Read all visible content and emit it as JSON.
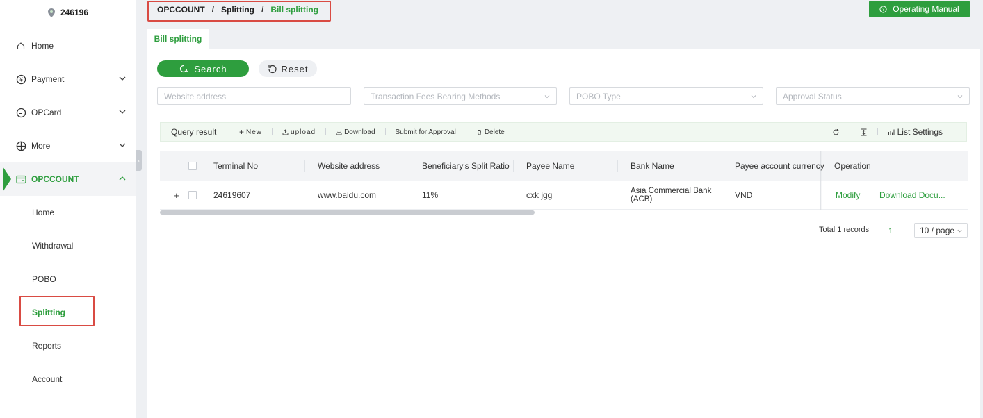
{
  "sidebar": {
    "account_id": "246196",
    "items": [
      {
        "label": "Home"
      },
      {
        "label": "Payment"
      },
      {
        "label": "OPCard"
      },
      {
        "label": "More"
      },
      {
        "label": "OPCCOUNT"
      }
    ],
    "sub_items": [
      {
        "label": "Home"
      },
      {
        "label": "Withdrawal"
      },
      {
        "label": "POBO"
      },
      {
        "label": "Splitting"
      },
      {
        "label": "Reports"
      },
      {
        "label": "Account"
      }
    ]
  },
  "breadcrumb": {
    "root": "OPCCOUNT",
    "sep": "/",
    "parent": "Splitting",
    "current": "Bill splitting"
  },
  "header": {
    "manual_label": "Operating Manual"
  },
  "tab": {
    "label": "Bill splitting"
  },
  "search": {
    "search_label": "Search",
    "reset_label": "Reset",
    "website_placeholder": "Website address",
    "fees_placeholder": "Transaction Fees Bearing Methods",
    "pobo_placeholder": "POBO Type",
    "approval_placeholder": "Approval Status"
  },
  "toolbar": {
    "title": "Query result",
    "new_label": "New",
    "upload_label": "upload",
    "download_label": "Download",
    "submit_label": "Submit for Approval",
    "delete_label": "Delete",
    "list_settings_label": "List Settings"
  },
  "table": {
    "columns": [
      "Terminal No",
      "Website address",
      "Beneficiary's Split Ratio",
      "Payee Name",
      "Bank Name",
      "Payee account currency",
      "Operation"
    ],
    "rows": [
      {
        "expand": "+",
        "terminal_no": "24619607",
        "website": "www.baidu.com",
        "ratio": "11%",
        "payee_name": "cxk jgg",
        "bank_name_1": "Asia Commercial Bank",
        "bank_name_2": "(ACB)",
        "currency": "VND",
        "op_modify": "Modify",
        "op_download": "Download Docu..."
      }
    ]
  },
  "pagination": {
    "total": "Total 1 records",
    "current_page": "1",
    "page_size": "10 / page"
  },
  "colors": {
    "accent": "#2e9e3e",
    "highlight": "#d94b43"
  }
}
